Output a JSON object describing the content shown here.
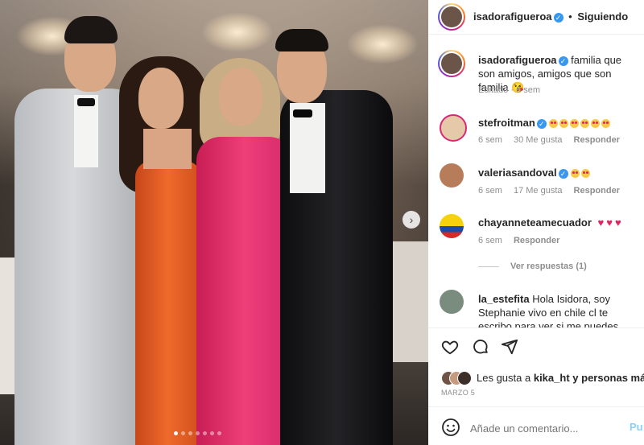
{
  "post": {
    "author": "isadorafigueroa",
    "follow_status": "Siguiendo",
    "dot": "•",
    "caption": "familia que son amigos, amigos que son familia 😘",
    "edited": "Editado · 6 sem",
    "likes_prefix": "Les gusta a",
    "likes_user": "kika_ht",
    "likes_suffix": "y personas más",
    "date": "MARZO 5",
    "comment_placeholder": "Añade un comentario...",
    "post_button": "Pu"
  },
  "comments": [
    {
      "user": "stefroitman",
      "verified": true,
      "text": "😍😍😍😍😍😍",
      "emoji_count": 6,
      "age": "6 sem",
      "likes": "30 Me gusta",
      "reply": "Responder"
    },
    {
      "user": "valeriasandoval",
      "verified": true,
      "text": "😍😍",
      "emoji_count": 2,
      "age": "6 sem",
      "likes": "17 Me gusta",
      "reply": "Responder"
    },
    {
      "user": "chayanneteamecuador",
      "verified": false,
      "text": "♥♥♥",
      "age": "6 sem",
      "reply": "Responder",
      "view_replies": "Ver respuestas (1)"
    },
    {
      "user": "la_estefita",
      "verified": false,
      "text": "Hola Isidora, soy Stephanie vivo en chile cl te escribo para ver si me puedes hacer un"
    }
  ],
  "colors": {
    "verified_blue": "#3897f0",
    "heart_red": "#e0245e",
    "post_blue": "#0095f6"
  },
  "icons": [
    "heart-icon",
    "comment-icon",
    "share-icon",
    "emoji-icon",
    "chevron-right-icon",
    "verified-icon"
  ]
}
